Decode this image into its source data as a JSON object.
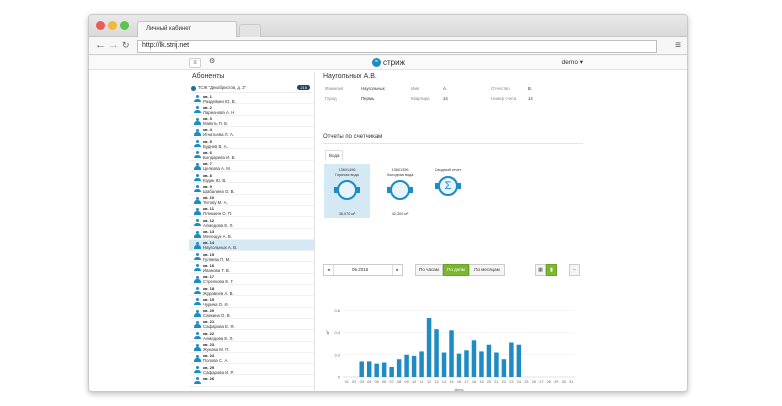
{
  "browser": {
    "tab_title": "Личный кабинет",
    "url": "http://lk.strij.net"
  },
  "app": {
    "logo_text": "стриж",
    "user": "demo ▾"
  },
  "sidebar": {
    "heading": "Абоненты",
    "group_name": "ТСЖ \"Декабристов, д. 2\"",
    "group_count": "215",
    "items": [
      {
        "num": "кв. 1",
        "name": "Раздеякин Ю. В."
      },
      {
        "num": "кв. 2",
        "name": "Ларионова А. Н."
      },
      {
        "num": "кв. 3",
        "name": "Маякть П. Б."
      },
      {
        "num": "кв. 4",
        "name": "Игнатьева Л. А."
      },
      {
        "num": "кв. 5",
        "name": "Буднев В. А."
      },
      {
        "num": "кв. 6",
        "name": "Болдарева И. Б."
      },
      {
        "num": "кв. 7",
        "name": "Цепкова А. М."
      },
      {
        "num": "кв. 8",
        "name": "Юдин Ю. В."
      },
      {
        "num": "кв. 9",
        "name": "Шабалина О. В."
      },
      {
        "num": "кв. 10",
        "name": "Титову М. А."
      },
      {
        "num": "кв. 11",
        "name": "Плешкин О. П."
      },
      {
        "num": "кв. 12",
        "name": "Алмедова Е. Л."
      },
      {
        "num": "кв. 13",
        "name": "Мелещук А. В."
      },
      {
        "num": "кв. 14",
        "name": "Наугольных А. В."
      },
      {
        "num": "кв. 15",
        "name": "Гуляева П. М."
      },
      {
        "num": "кв. 16",
        "name": "Иванова Т. В."
      },
      {
        "num": "кв. 17",
        "name": "Стрелкова Е. Г."
      },
      {
        "num": "кв. 18",
        "name": "Журавлев А. В."
      },
      {
        "num": "кв. 19",
        "name": "Чурина О. И."
      },
      {
        "num": "кв. 20",
        "name": "Савкина О. В."
      },
      {
        "num": "кв. 21",
        "name": "Сафарова Е. Я."
      },
      {
        "num": "кв. 22",
        "name": "Алмедова Е. Л."
      },
      {
        "num": "кв. 23",
        "name": "Жукова М. П."
      },
      {
        "num": "кв. 24",
        "name": "Попова С. А."
      },
      {
        "num": "кв. 25",
        "name": "Сафарова И. Р."
      },
      {
        "num": "кв. 26",
        "name": ""
      }
    ],
    "selected_index": 13
  },
  "subscriber": {
    "name": "Наугольных А.В.",
    "fields": {
      "surname_label": "Фамилия",
      "surname": "Наугольных",
      "first_label": "Имя",
      "first": "А.",
      "patronymic_label": "Отчество",
      "patronymic": "В.",
      "city_label": "Город",
      "city": "Пермь",
      "flat_label": "Квартира",
      "flat": "14",
      "meter_label": "Номер счета",
      "meter": "14"
    }
  },
  "reports": {
    "heading": "Отчеты по счетчикам",
    "tab": "Вода",
    "cards": [
      {
        "id": "13601496",
        "label": "Горячая вода",
        "value": "36,070 м³"
      },
      {
        "id": "13601396",
        "label": "Холодная вода",
        "value": "42,300 м³"
      },
      {
        "id": "",
        "label": "Сводный отчет",
        "value": ""
      }
    ],
    "date": "05.2015",
    "periods": [
      "По часам",
      "По дням",
      "По месяцам"
    ],
    "active_period": 1
  },
  "chart_data": {
    "type": "bar",
    "xlabel": "День",
    "ylabel": "м³",
    "ylim": [
      0,
      0.8
    ],
    "yticks": [
      "0",
      "0.2",
      "0.4",
      "0.6"
    ],
    "categories": [
      "01",
      "02",
      "03",
      "04",
      "05",
      "06",
      "07",
      "08",
      "09",
      "10",
      "11",
      "12",
      "13",
      "14",
      "15",
      "16",
      "17",
      "18",
      "19",
      "20",
      "21",
      "22",
      "23",
      "24",
      "25",
      "26",
      "27",
      "28",
      "29",
      "30",
      "31"
    ],
    "values": [
      0,
      0,
      0.14,
      0.14,
      0.12,
      0.13,
      0.09,
      0.16,
      0.2,
      0.19,
      0.23,
      0.53,
      0.43,
      0.22,
      0.42,
      0.21,
      0.24,
      0.33,
      0.23,
      0.29,
      0.22,
      0.16,
      0.31,
      0.29,
      0,
      0,
      0,
      0,
      0,
      0,
      0
    ],
    "color": "#1e8bc3"
  },
  "colors": {
    "accent": "#1e8bc3",
    "green": "#7cb82f"
  }
}
